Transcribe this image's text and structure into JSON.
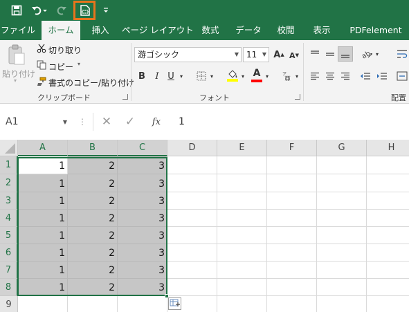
{
  "colors": {
    "brand": "#217346",
    "highlight": "#e8741c",
    "selection_fill": "#c6c6c6"
  },
  "qat": {
    "icons": [
      "save-icon",
      "undo-icon",
      "redo-icon",
      "print-preview-icon",
      "customize-dropdown-icon"
    ]
  },
  "tabs": [
    "ファイル",
    "ホーム",
    "挿入",
    "ページ レイアウト",
    "数式",
    "データ",
    "校閲",
    "表示",
    "PDFelement"
  ],
  "active_tab": "ホーム",
  "ribbon": {
    "clipboard": {
      "paste": "貼り付け",
      "cut": "切り取り",
      "copy": "コピー",
      "format_painter": "書式のコピー/貼り付け",
      "group": "クリップボード"
    },
    "font": {
      "font_name": "游ゴシック",
      "font_size": "11",
      "bold": "B",
      "italic": "I",
      "underline": "U",
      "group": "フォント",
      "fill_color": "#ffff00",
      "font_color": "#ff0000",
      "font_color_letter": "A"
    },
    "alignment": {
      "group": "配置"
    }
  },
  "formula_bar": {
    "name_box": "A1",
    "fx": "fx",
    "value": "1"
  },
  "sheet": {
    "columns": [
      "A",
      "B",
      "C",
      "D",
      "E",
      "F",
      "G",
      "H"
    ],
    "rows": [
      "1",
      "2",
      "3",
      "4",
      "5",
      "6",
      "7",
      "8",
      "9"
    ],
    "data": [
      [
        "1",
        "2",
        "3"
      ],
      [
        "1",
        "2",
        "3"
      ],
      [
        "1",
        "2",
        "3"
      ],
      [
        "1",
        "2",
        "3"
      ],
      [
        "1",
        "2",
        "3"
      ],
      [
        "1",
        "2",
        "3"
      ],
      [
        "1",
        "2",
        "3"
      ],
      [
        "1",
        "2",
        "3"
      ]
    ],
    "selection": "A1:C8",
    "active_cell": "A1"
  }
}
